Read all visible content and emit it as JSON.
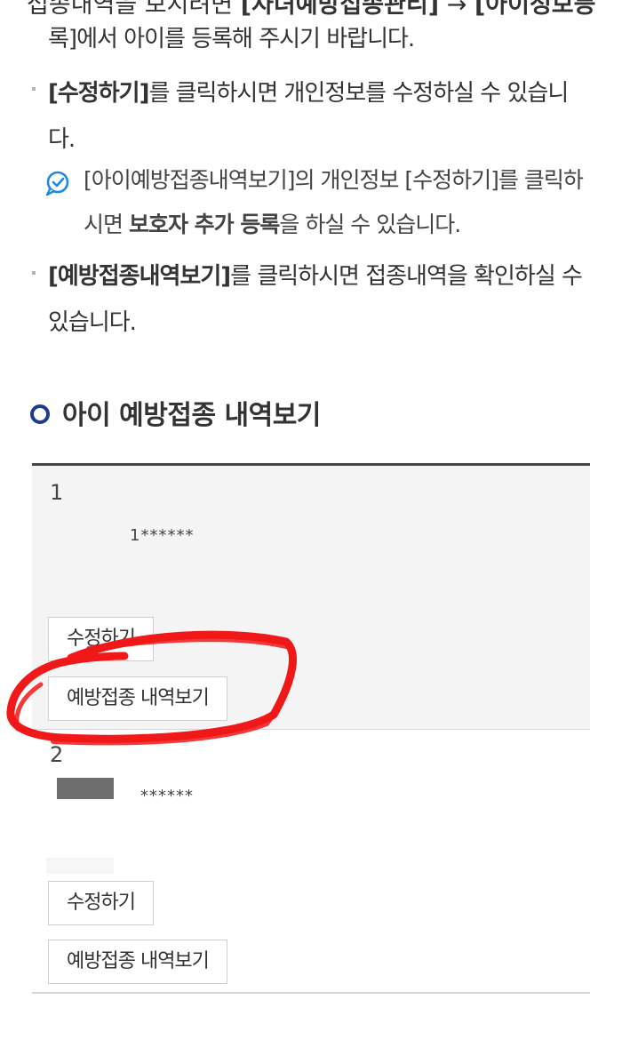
{
  "guide": {
    "cut_line_html_parts": [
      "접종내역을 보시려면 ",
      "[자녀예방접종관리]",
      " → ",
      "[아이정보등"
    ],
    "para1_line2": "록]에서 아이를 등록해 주시기 바랍니다.",
    "para2_bold": "[수정하기]",
    "para2_rest": "를 클릭하시면 개인정보를 수정하실 수 있습니다.",
    "note_prefix": "[아이예방접종내역보기]의 개인정보 [수정하기]를 클릭하시면 ",
    "note_bold": "보호자 추가 등록",
    "note_suffix": "을 하실 수 있습니다.",
    "para3_bold": "[예방접종내역보기]",
    "para3_rest": "를 클릭하시면 접종내역을 확인하실 수 있습니다."
  },
  "section": {
    "title": "아이 예방접종 내역보기"
  },
  "children": [
    {
      "number": "1",
      "masked_id": "1******",
      "edit_label": "수정하기",
      "history_label": "예방접종 내역보기"
    },
    {
      "number": "2",
      "masked_id": "******",
      "edit_label": "수정하기",
      "history_label": "예방접종 내역보기"
    }
  ],
  "colors": {
    "accent_circle": "#1e3c8c",
    "note_icon": "#1e88e5",
    "annotation_red": "#f01818"
  },
  "icons": {
    "note": "check-speech-bubble-icon",
    "section": "circle-bullet-icon"
  }
}
